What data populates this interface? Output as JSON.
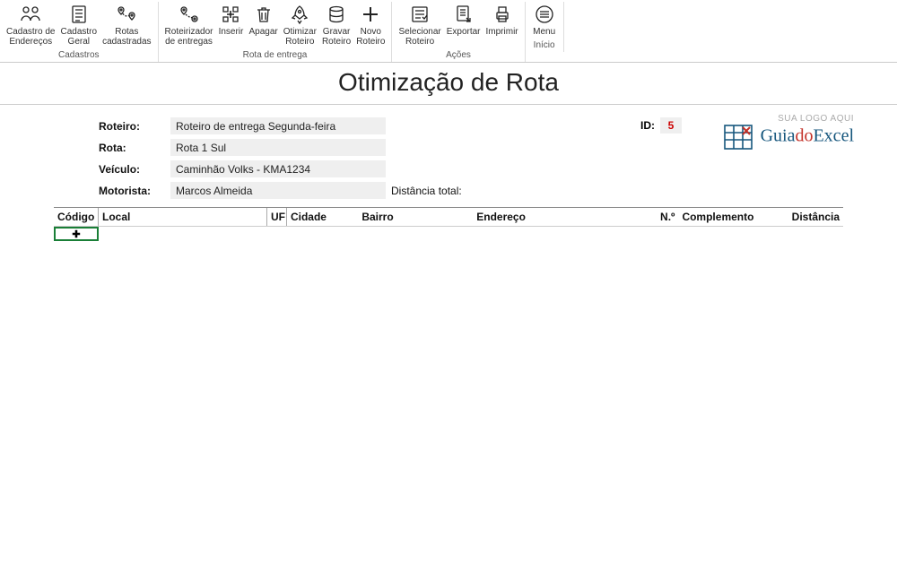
{
  "ribbon": {
    "groups": [
      {
        "title": "Cadastros",
        "buttons": [
          {
            "label": "Cadastro de\nEndereços"
          },
          {
            "label": "Cadastro\nGeral"
          },
          {
            "label": "Rotas\ncadastradas"
          }
        ]
      },
      {
        "title": "Rota de entrega",
        "buttons": [
          {
            "label": "Roteirizador\nde entregas"
          },
          {
            "label": "Inserir"
          },
          {
            "label": "Apagar"
          },
          {
            "label": "Otimizar\nRoteiro"
          },
          {
            "label": "Gravar\nRoteiro"
          },
          {
            "label": "Novo\nRoteiro"
          }
        ]
      },
      {
        "title": "Ações",
        "buttons": [
          {
            "label": "Selecionar\nRoteiro"
          },
          {
            "label": "Exportar"
          },
          {
            "label": "Imprimir"
          }
        ]
      },
      {
        "title": "Início",
        "buttons": [
          {
            "label": "Menu"
          }
        ]
      }
    ]
  },
  "page": {
    "title": "Otimização de Rota"
  },
  "form": {
    "roteiro_label": "Roteiro:",
    "roteiro_value": "Roteiro de entrega Segunda-feira",
    "rota_label": "Rota:",
    "rota_value": "Rota 1 Sul",
    "veiculo_label": "Veículo:",
    "veiculo_value": "Caminhão Volks - KMA1234",
    "motorista_label": "Motorista:",
    "motorista_value": "Marcos Almeida",
    "id_label": "ID:",
    "id_value": "5",
    "distancia_total_label": "Distância total:"
  },
  "logo": {
    "tagline": "SUA LOGO AQUI",
    "part1": "Guia",
    "part2": "do",
    "part3": "Excel"
  },
  "table": {
    "headers": {
      "codigo": "Código",
      "local": "Local",
      "uf": "UF",
      "cidade": "Cidade",
      "bairro": "Bairro",
      "endereco": "Endereço",
      "no": "N.º",
      "complemento": "Complemento",
      "distancia": "Distância"
    }
  }
}
